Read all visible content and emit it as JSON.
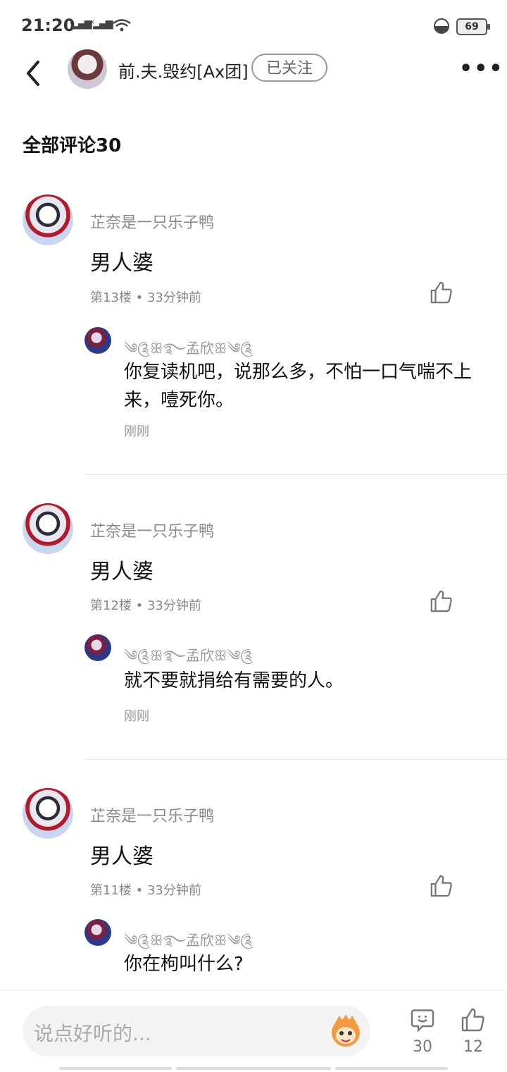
{
  "status": {
    "time": "21:20",
    "battery": "69"
  },
  "header": {
    "title": "前.夫.毁约[Ax团]",
    "follow_label": "已关注",
    "more": "•••"
  },
  "section_title": "全部评论30",
  "comments": [
    {
      "user": "芷奈是一只乐子鸭",
      "text": "男人婆",
      "floor": "第13楼 • 33分钟前",
      "reply": {
        "user": "༄༊ꕥ࿐孟欣ꕥ༄༊",
        "text": "你复读机吧，说那么多，不怕一口气喘不上来，噎死你。",
        "time": "刚刚"
      }
    },
    {
      "user": "芷奈是一只乐子鸭",
      "text": "男人婆",
      "floor": "第12楼 • 33分钟前",
      "reply": {
        "user": "༄༊ꕥ࿐孟欣ꕥ༄༊",
        "text": "就不要就捐给有需要的人。",
        "time": "刚刚"
      }
    },
    {
      "user": "芷奈是一只乐子鸭",
      "text": "男人婆",
      "floor": "第11楼 • 33分钟前",
      "reply": {
        "user": "༄༊ꕥ࿐孟欣ꕥ༄༊",
        "text": "你在枸叫什么?",
        "time": ""
      }
    }
  ],
  "bottom": {
    "placeholder": "说点好听的...",
    "comment_count": "30",
    "like_count": "12"
  },
  "icons": {
    "back": "chevron-left-icon",
    "like": "thumbs-up-icon",
    "comment": "comment-smile-icon",
    "emoji": "monkey-emoji-icon"
  }
}
